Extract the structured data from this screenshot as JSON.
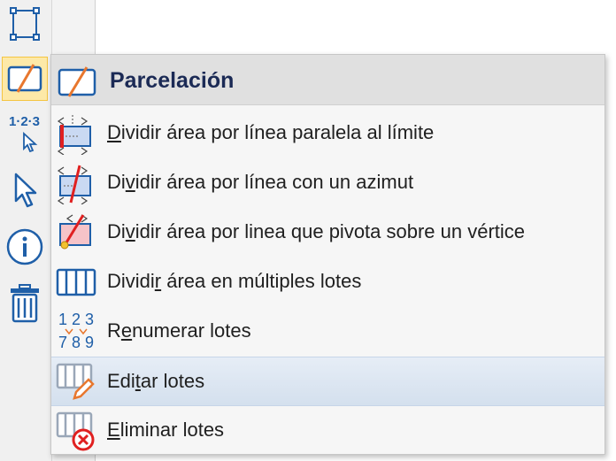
{
  "toolbar": {
    "icons": [
      "rectangle-points-icon",
      "parcel-icon",
      "numbering-cursor-icon",
      "pointer-icon",
      "info-icon",
      "trash-icon"
    ],
    "numbering_label": "1·2·3"
  },
  "menu": {
    "title": "Parcelación",
    "items": [
      {
        "label": "Dividir área por línea paralela al límite",
        "mnemonic_index": 0,
        "icon": "split-parallel-icon"
      },
      {
        "label": "Dividir área por línea con un azimut",
        "mnemonic_index": 2,
        "icon": "split-azimuth-icon"
      },
      {
        "label": "Dividir área por linea que pivota sobre un vértice",
        "mnemonic_index": 2,
        "icon": "split-pivot-icon"
      },
      {
        "label": "Dividir área en múltiples lotes",
        "mnemonic_index": 6,
        "icon": "multiple-lots-icon"
      },
      {
        "label": "Renumerar lotes",
        "mnemonic_index": 1,
        "icon": "renumber-icon"
      },
      {
        "label": "Editar lotes",
        "mnemonic_index": 3,
        "icon": "edit-lots-icon"
      },
      {
        "label": "Eliminar lotes",
        "mnemonic_index": 0,
        "icon": "delete-lots-icon"
      }
    ],
    "renumber_digits": [
      "1",
      "2",
      "3",
      "7",
      "8",
      "9"
    ]
  },
  "colors": {
    "accent": "#1f6fbf",
    "active": "#fde9a8",
    "orange": "#e8772e",
    "red": "#e02020"
  }
}
